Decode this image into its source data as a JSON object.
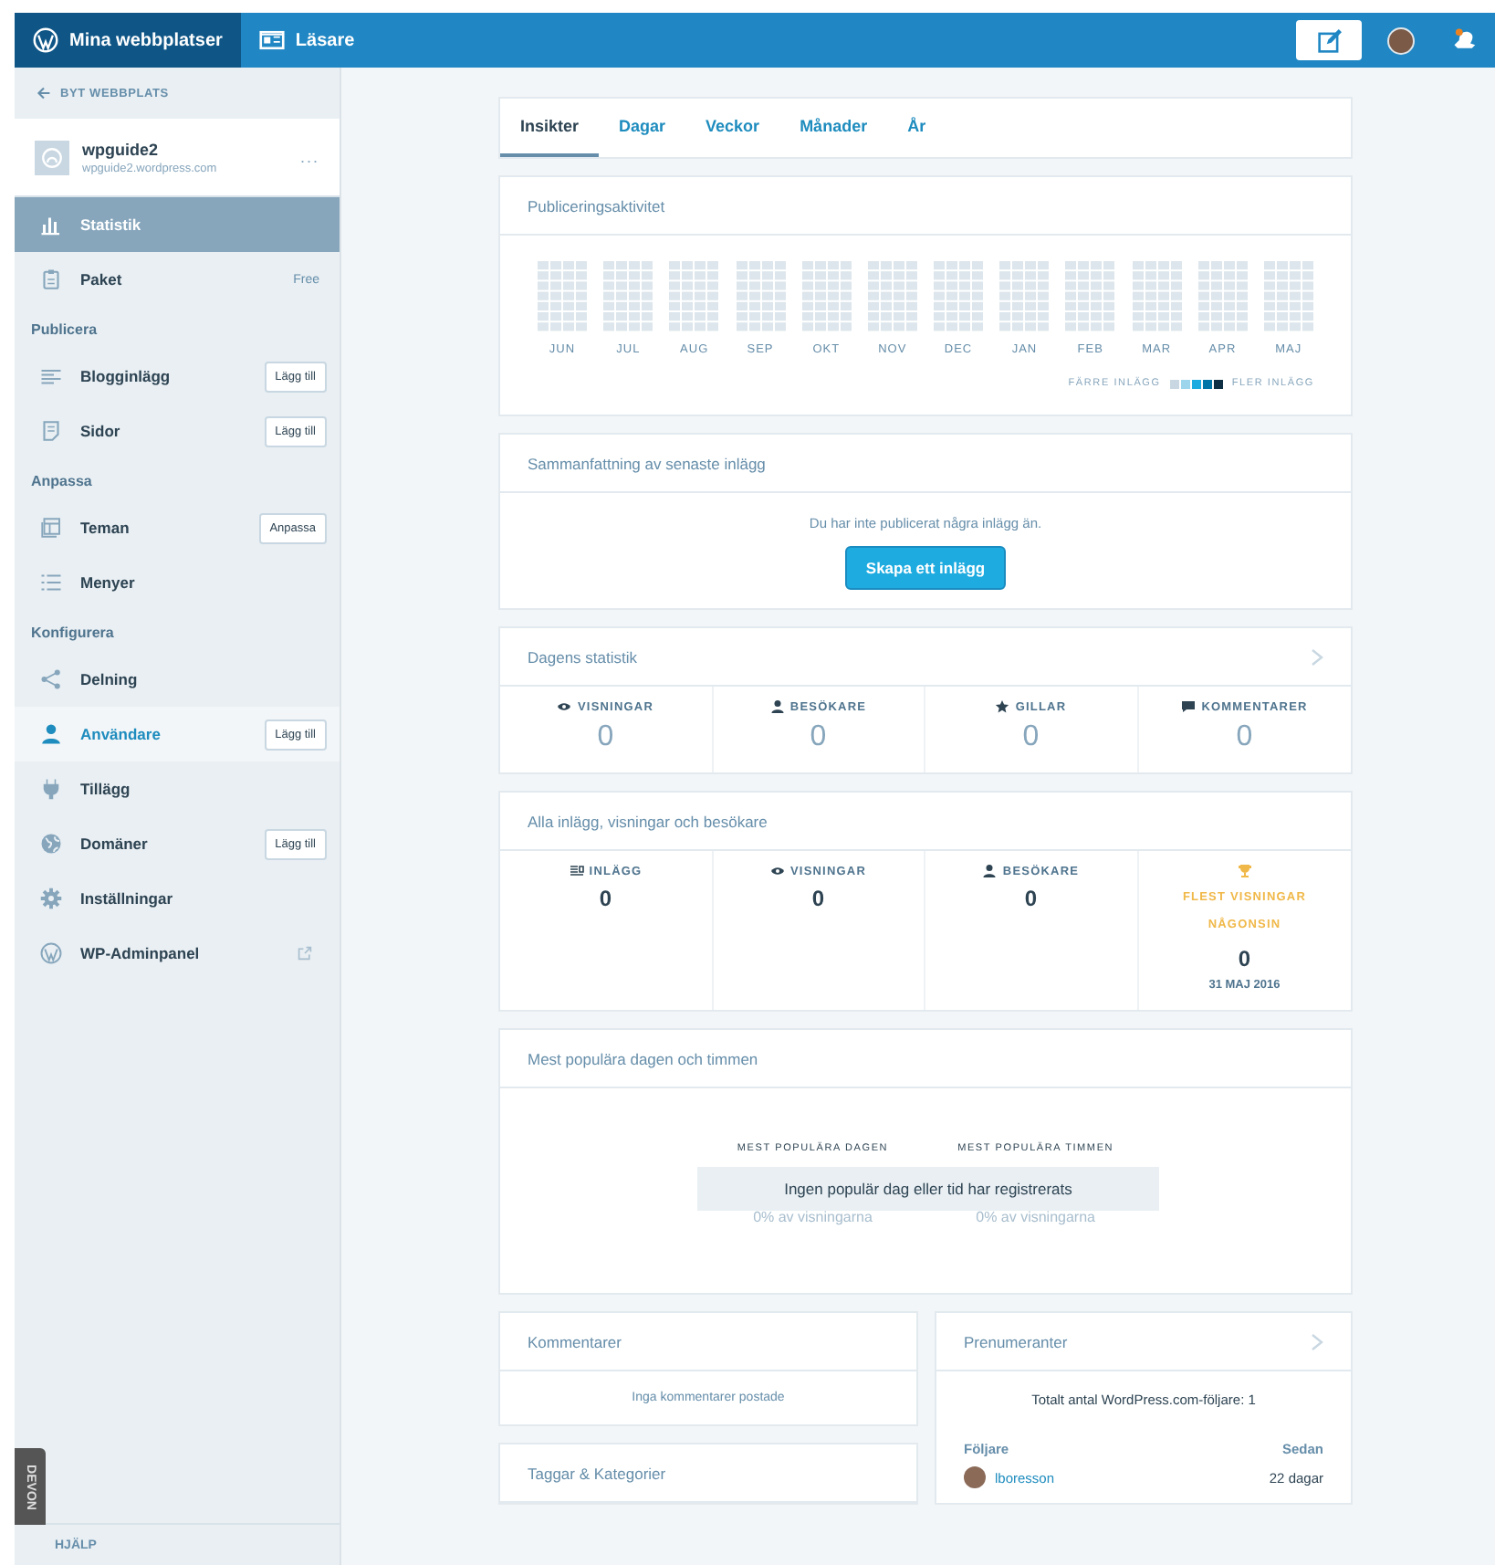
{
  "topbar": {
    "my_sites": "Mina webbplatser",
    "reader": "Läsare"
  },
  "sidebar": {
    "switch_site": "BYT WEBBPLATS",
    "site": {
      "name": "wpguide2",
      "url": "wpguide2.wordpress.com",
      "more": "..."
    },
    "items": [
      {
        "kind": "item",
        "label": "Statistik",
        "selected": true,
        "hovered": false
      },
      {
        "kind": "item",
        "label": "Paket",
        "badge": "Free",
        "selected": false,
        "hovered": false
      },
      {
        "kind": "heading",
        "label": "Publicera"
      },
      {
        "kind": "item",
        "label": "Blogginlägg",
        "button": "Lägg till",
        "selected": false,
        "hovered": false
      },
      {
        "kind": "item",
        "label": "Sidor",
        "button": "Lägg till",
        "selected": false,
        "hovered": false
      },
      {
        "kind": "heading",
        "label": "Anpassa"
      },
      {
        "kind": "item",
        "label": "Teman",
        "button": "Anpassa",
        "selected": false,
        "hovered": false
      },
      {
        "kind": "item",
        "label": "Menyer",
        "selected": false,
        "hovered": false
      },
      {
        "kind": "heading",
        "label": "Konfigurera"
      },
      {
        "kind": "item",
        "label": "Delning",
        "selected": false,
        "hovered": false
      },
      {
        "kind": "item",
        "label": "Användare",
        "button": "Lägg till",
        "selected": false,
        "hovered": true
      },
      {
        "kind": "item",
        "label": "Tillägg",
        "selected": false,
        "hovered": false
      },
      {
        "kind": "item",
        "label": "Domäner",
        "button": "Lägg till",
        "selected": false,
        "hovered": false
      },
      {
        "kind": "item",
        "label": "Inställningar",
        "selected": false,
        "hovered": false
      },
      {
        "kind": "item",
        "label": "WP-Adminpanel",
        "external": true,
        "selected": false,
        "hovered": false
      }
    ],
    "side_tab": "DEVON",
    "help": "HJÄLP"
  },
  "tabs": [
    {
      "label": "Insikter",
      "selected": true
    },
    {
      "label": "Dagar",
      "selected": false
    },
    {
      "label": "Veckor",
      "selected": false
    },
    {
      "label": "Månader",
      "selected": false
    },
    {
      "label": "År",
      "selected": false
    }
  ],
  "publishing": {
    "title": "Publiceringsaktivitet",
    "months": [
      "JUN",
      "JUL",
      "AUG",
      "SEP",
      "OKT",
      "NOV",
      "DEC",
      "JAN",
      "FEB",
      "MAR",
      "APR",
      "MAJ"
    ],
    "legend": {
      "fewer": "FÄRRE INLÄGG",
      "more": "FLER INLÄGG"
    }
  },
  "latest": {
    "title": "Sammanfattning av senaste inlägg",
    "message": "Du har inte publicerat några inlägg än.",
    "button": "Skapa ett inlägg"
  },
  "today": {
    "title": "Dagens statistik",
    "stats": [
      {
        "label": "VISNINGAR",
        "value": "0"
      },
      {
        "label": "BESÖKARE",
        "value": "0"
      },
      {
        "label": "GILLAR",
        "value": "0"
      },
      {
        "label": "KOMMENTARER",
        "value": "0"
      }
    ]
  },
  "all_time": {
    "title": "Alla inlägg, visningar och besökare",
    "stats": [
      {
        "kind": "plain",
        "label": "INLÄGG",
        "value": "0"
      },
      {
        "kind": "plain",
        "label": "VISNINGAR",
        "value": "0"
      },
      {
        "kind": "plain",
        "label": "BESÖKARE",
        "value": "0"
      },
      {
        "kind": "best",
        "label": "FLEST VISNINGAR NÅGONSIN",
        "value": "0",
        "date": "31 MAJ 2016"
      }
    ]
  },
  "popular": {
    "title": "Mest populära dagen och timmen",
    "day_label": "MEST POPULÄRA DAGEN",
    "hour_label": "MEST POPULÄRA TIMMEN",
    "day_share": "0% av visningarna",
    "hour_share": "0% av visningarna",
    "notice": "Ingen populär dag eller tid har registrerats"
  },
  "comments": {
    "title": "Kommentarer",
    "message": "Inga kommentarer postade"
  },
  "tags": {
    "title": "Taggar & Kategorier"
  },
  "followers": {
    "title": "Prenumeranter",
    "total": "Totalt antal WordPress.com-följare: 1",
    "col_follower": "Följare",
    "col_since": "Sedan",
    "rows": [
      {
        "name": "lboresson",
        "since": "22 dagar"
      }
    ]
  }
}
